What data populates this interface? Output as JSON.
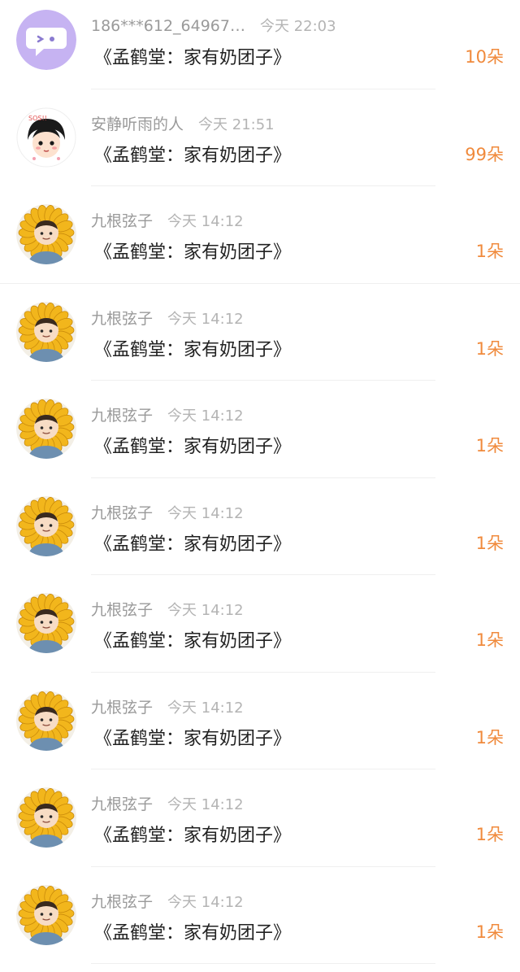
{
  "colors": {
    "count": "#f08a3c",
    "name": "#9a9a9a",
    "time": "#b4b4b4",
    "title": "#222222"
  },
  "rows": [
    {
      "avatar": "speech-bubble-face-avatar",
      "name": "186***612_64967…",
      "time": "今天 22:03",
      "work": "《孟鹤堂：家有奶团子》",
      "count": "10朵"
    },
    {
      "avatar": "cartoon-boy-avatar",
      "name": "安静听雨的人",
      "time": "今天 21:51",
      "work": "《孟鹤堂：家有奶团子》",
      "count": "99朵"
    },
    {
      "avatar": "sunflower-avatar",
      "name": "九根弦子",
      "time": "今天 14:12",
      "work": "《孟鹤堂：家有奶团子》",
      "count": "1朵"
    },
    {
      "avatar": "sunflower-avatar",
      "name": "九根弦子",
      "time": "今天 14:12",
      "work": "《孟鹤堂：家有奶团子》",
      "count": "1朵"
    },
    {
      "avatar": "sunflower-avatar",
      "name": "九根弦子",
      "time": "今天 14:12",
      "work": "《孟鹤堂：家有奶团子》",
      "count": "1朵"
    },
    {
      "avatar": "sunflower-avatar",
      "name": "九根弦子",
      "time": "今天 14:12",
      "work": "《孟鹤堂：家有奶团子》",
      "count": "1朵"
    },
    {
      "avatar": "sunflower-avatar",
      "name": "九根弦子",
      "time": "今天 14:12",
      "work": "《孟鹤堂：家有奶团子》",
      "count": "1朵"
    },
    {
      "avatar": "sunflower-avatar",
      "name": "九根弦子",
      "time": "今天 14:12",
      "work": "《孟鹤堂：家有奶团子》",
      "count": "1朵"
    },
    {
      "avatar": "sunflower-avatar",
      "name": "九根弦子",
      "time": "今天 14:12",
      "work": "《孟鹤堂：家有奶团子》",
      "count": "1朵"
    },
    {
      "avatar": "sunflower-avatar",
      "name": "九根弦子",
      "time": "今天 14:12",
      "work": "《孟鹤堂：家有奶团子》",
      "count": "1朵"
    }
  ]
}
